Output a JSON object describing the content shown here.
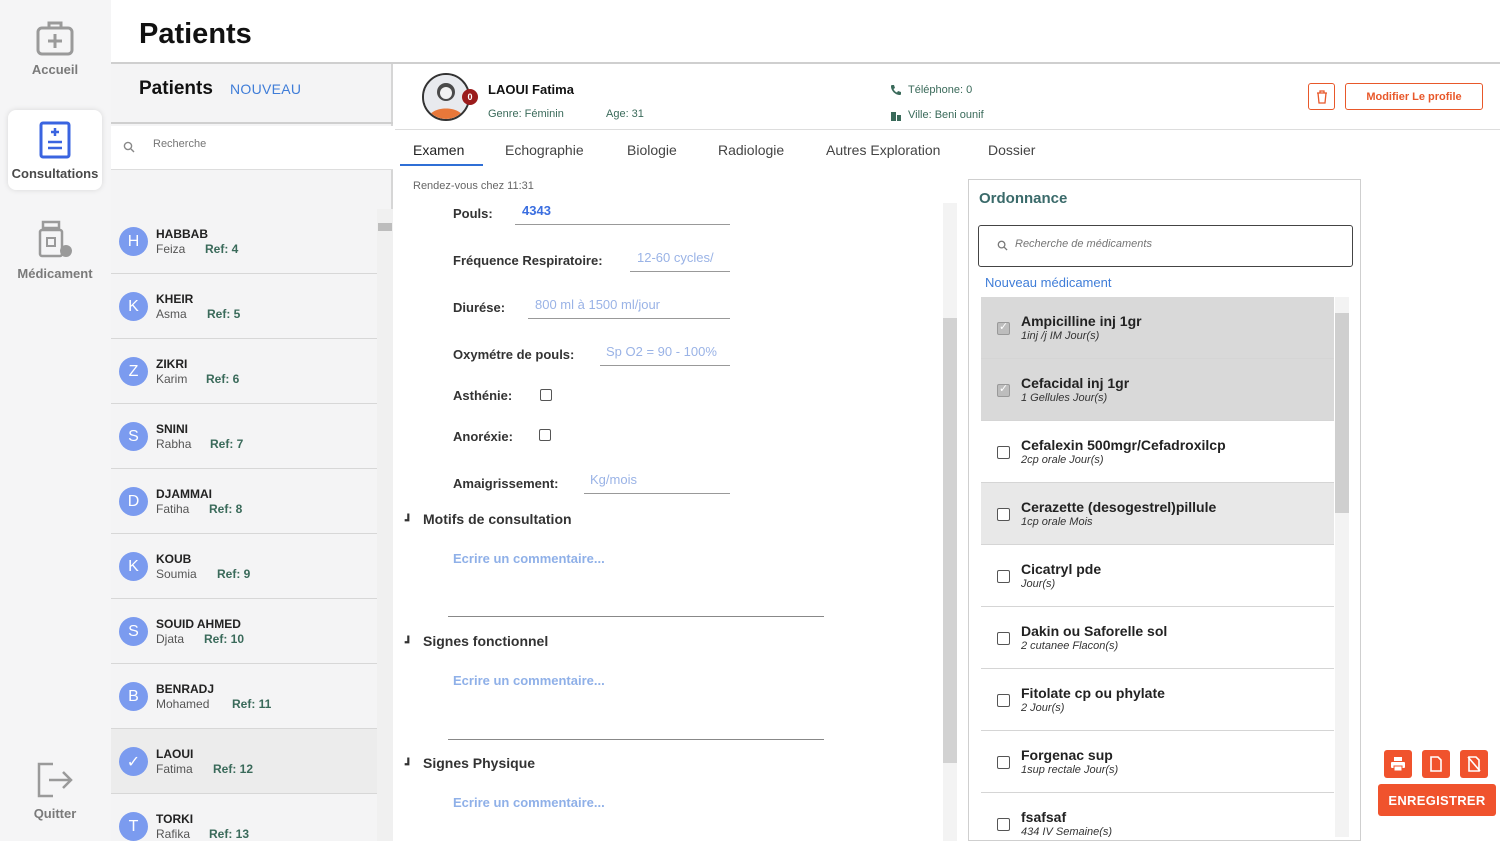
{
  "page": {
    "title": "Patients"
  },
  "nav": {
    "items": [
      {
        "label": "Accueil",
        "icon": "medical-case-icon"
      },
      {
        "label": "Consultations",
        "icon": "clipboard-icon"
      },
      {
        "label": "Médicament",
        "icon": "pharmacy-icon"
      }
    ],
    "quit": {
      "label": "Quitter",
      "icon": "logout-icon"
    }
  },
  "patients_panel": {
    "title": "Patients",
    "new_label": "NOUVEAU",
    "search_placeholder": "Recherche",
    "rows": [
      {
        "initial": "H",
        "last": "HABBAB",
        "first": "Feiza",
        "ref": "Ref: 4"
      },
      {
        "initial": "K",
        "last": "KHEIR",
        "first": "Asma",
        "ref": "Ref: 5"
      },
      {
        "initial": "Z",
        "last": "ZIKRI",
        "first": "Karim",
        "ref": "Ref: 6"
      },
      {
        "initial": "S",
        "last": "SNINI",
        "first": "Rabha",
        "ref": "Ref: 7"
      },
      {
        "initial": "D",
        "last": "DJAMMAI",
        "first": "Fatiha",
        "ref": "Ref: 8"
      },
      {
        "initial": "K",
        "last": "KOUB",
        "first": "Soumia",
        "ref": "Ref: 9"
      },
      {
        "initial": "S",
        "last": "SOUID AHMED",
        "first": "Djata",
        "ref": "Ref: 10"
      },
      {
        "initial": "B",
        "last": "BENRADJ",
        "first": "Mohamed",
        "ref": "Ref: 11"
      },
      {
        "initial": "✓",
        "last": "LAOUI",
        "first": "Fatima",
        "ref": "Ref: 12"
      },
      {
        "initial": "T",
        "last": "TORKI",
        "first": "Rafika",
        "ref": "Ref: 13"
      }
    ]
  },
  "patient_header": {
    "name": "LAOUI Fatima",
    "badge": "0",
    "genre": "Genre: Féminin",
    "age": "Age: 31",
    "telephone": "Téléphone: 0",
    "ville": "Ville: Beni ounif",
    "edit_label": "Modifier Le profile"
  },
  "tabs": [
    "Examen",
    "Echographie",
    "Biologie",
    "Radiologie",
    "Autres Exploration",
    "Dossier"
  ],
  "exam": {
    "rdv": "Rendez-vous chez 11:31",
    "pouls_label": "Pouls:",
    "pouls_value": "4343",
    "freq_label": "Fréquence Respiratoire:",
    "freq_placeholder": "12-60 cycles/",
    "diurese_label": "Diurése:",
    "diurese_placeholder": "800 ml à 1500 ml/jour",
    "oxy_label": "Oxymétre de pouls:",
    "oxy_placeholder": "Sp O2 = 90 - 100%",
    "asthenie_label": "Asthénie:",
    "anorexie_label": "Anoréxie:",
    "amaig_label": "Amaigrissement:",
    "amaig_placeholder": "Kg/mois",
    "sections": [
      {
        "title": "Motifs de consultation",
        "comment": "Ecrire un commentaire..."
      },
      {
        "title": "Signes fonctionnel",
        "comment": "Ecrire un commentaire..."
      },
      {
        "title": "Signes Physique",
        "comment": "Ecrire un commentaire..."
      }
    ]
  },
  "ordonnance": {
    "title": "Ordonnance",
    "search_placeholder": "Recherche de médicaments",
    "new_label": "Nouveau médicament",
    "meds": [
      {
        "name": "Ampicilline  inj 1gr",
        "dose": "1inj /j IM Jour(s)",
        "checked": true
      },
      {
        "name": "Cefacidal inj 1gr",
        "dose": "1 Gellules Jour(s)",
        "checked": true
      },
      {
        "name": "Cefalexin 500mgr/Cefadroxilcp",
        "dose": "2cp orale Jour(s)",
        "checked": false
      },
      {
        "name": "Cerazette (desogestrel)pillule",
        "dose": "1cp orale Mois",
        "checked": false
      },
      {
        "name": "Cicatryl pde",
        "dose": " Jour(s)",
        "checked": false
      },
      {
        "name": "Dakin ou Saforelle sol",
        "dose": "2 cutanee Flacon(s)",
        "checked": false
      },
      {
        "name": "Fitolate cp ou phylate",
        "dose": "2  Jour(s)",
        "checked": false
      },
      {
        "name": "Forgenac sup",
        "dose": "1sup rectale Jour(s)",
        "checked": false
      },
      {
        "name": "fsafsaf",
        "dose": "434 IV Semaine(s)",
        "checked": false
      }
    ]
  },
  "actions": {
    "save_label": "ENREGISTRER",
    "icons": [
      "print-icon",
      "document-icon",
      "clear-document-icon"
    ]
  },
  "colors": {
    "accent": "#f0532d",
    "link": "#3f7dd8",
    "avatar": "#7b9bef",
    "teal_text": "#3a6a5a"
  }
}
